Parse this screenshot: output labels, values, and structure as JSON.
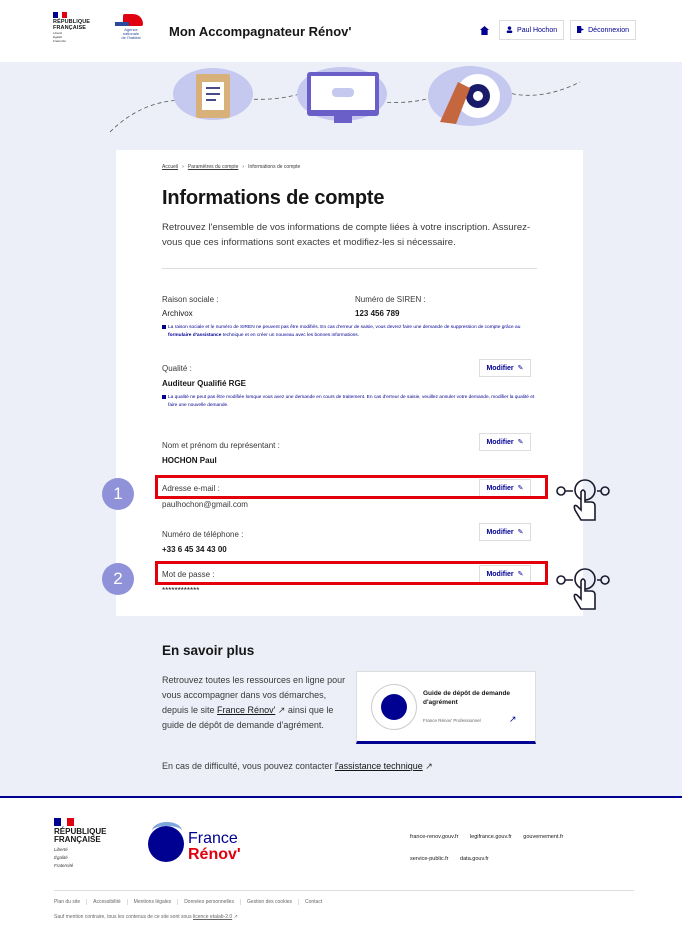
{
  "header": {
    "rf_title": [
      "RÉPUBLIQUE",
      "FRANÇAISE"
    ],
    "rf_motto": [
      "Liberté",
      "Égalité",
      "Fraternité"
    ],
    "anah_text": [
      "Agence",
      "nationale",
      "de l'habitat"
    ],
    "site_title": "Mon Accompagnateur Rénov'",
    "user_label": "Paul Hochon",
    "logout_label": "Déconnexion"
  },
  "breadcrumb": {
    "home": "Accueil",
    "params": "Paramètres du compte",
    "current": "Informations de compte"
  },
  "page": {
    "title": "Informations de compte",
    "intro": "Retrouvez l'ensemble de vos informations de compte liées à votre inscription. Assurez-vous que ces informations sont exactes et modifiez-les si nécessaire."
  },
  "fields": {
    "raison_label": "Raison sociale :",
    "raison_value": "Archivox",
    "siren_label": "Numéro de SIREN :",
    "siren_value": "123 456 789",
    "siren_info_a": "La raison sociale et le numéro de SIREN ne peuvent pas être modifiés. En cas d'erreur de saisie, vous devrez faire une demande de suppression de compte grâce au ",
    "siren_info_link": "formulaire d'assistance",
    "siren_info_b": " technique et en créer un nouveau avec les bonnes informations.",
    "qualite_label": "Qualité :",
    "qualite_value": "Auditeur Qualifié RGE",
    "qualite_info": "La qualité ne peut pas être modifiée lorsque vous avez une demande en cours de traitement. En cas d'erreur de saisie, veuillez annuler votre demande, modifier la qualité et faire une nouvelle demande.",
    "rep_label": "Nom et prénom du représentant :",
    "rep_value": "HOCHON Paul",
    "email_label": "Adresse e-mail :",
    "email_value": "paulhochon@gmail.com",
    "tel_label": "Numéro de téléphone :",
    "tel_value": "+33 6 45 34 43 00",
    "pwd_label": "Mot de passe :",
    "pwd_value": "************",
    "modify_label": "Modifier"
  },
  "annotations": {
    "step1": "1",
    "step2": "2"
  },
  "more": {
    "title": "En savoir plus",
    "text_a": "Retrouvez toutes les ressources en ligne pour vous accompagner dans vos démarches, depuis le site ",
    "text_link": "France Rénov'",
    "text_b": " ainsi que le guide de dépôt de demande d'agrément.",
    "guide_title": "Guide de dépôt de demande d'agrément",
    "guide_sub": "France Rénov' Professionnel",
    "contact_a": "En cas de difficulté, vous pouvez contacter ",
    "contact_link": "l'assistance technique"
  },
  "footer": {
    "rf_title": [
      "RÉPUBLIQUE",
      "FRANÇAISE"
    ],
    "rf_motto": [
      "Liberté",
      "Égalité",
      "Fraternité"
    ],
    "brand_1": "France",
    "brand_2": "Rénov'",
    "links": [
      "france-renov.gouv.fr",
      "legifrance.gouv.fr",
      "gouvernement.fr",
      "service-public.fr",
      "data.gouv.fr"
    ],
    "bottom_links": [
      "Plan du site",
      "Accessibilité",
      "Mentions légales",
      "Données personnelles",
      "Gestion des cookies",
      "Contact"
    ],
    "licence_a": "Sauf mention contraire, tous les contenus de ce site sont sous ",
    "licence_link": "licence etalab-2.0"
  },
  "colors": {
    "primary": "#000091",
    "accent_red": "#e1000f",
    "highlight": "#e3000b",
    "hero_bg": "#eceff8",
    "step_badge": "#8f92d9"
  }
}
